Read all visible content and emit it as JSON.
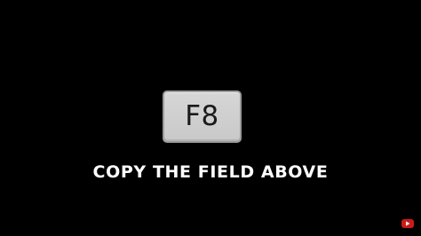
{
  "key": {
    "label": "F8"
  },
  "caption": {
    "text": "COPY THE FIELD ABOVE"
  },
  "badge": {
    "icon": "youtube-play-icon",
    "color": "#cc1a1a"
  }
}
